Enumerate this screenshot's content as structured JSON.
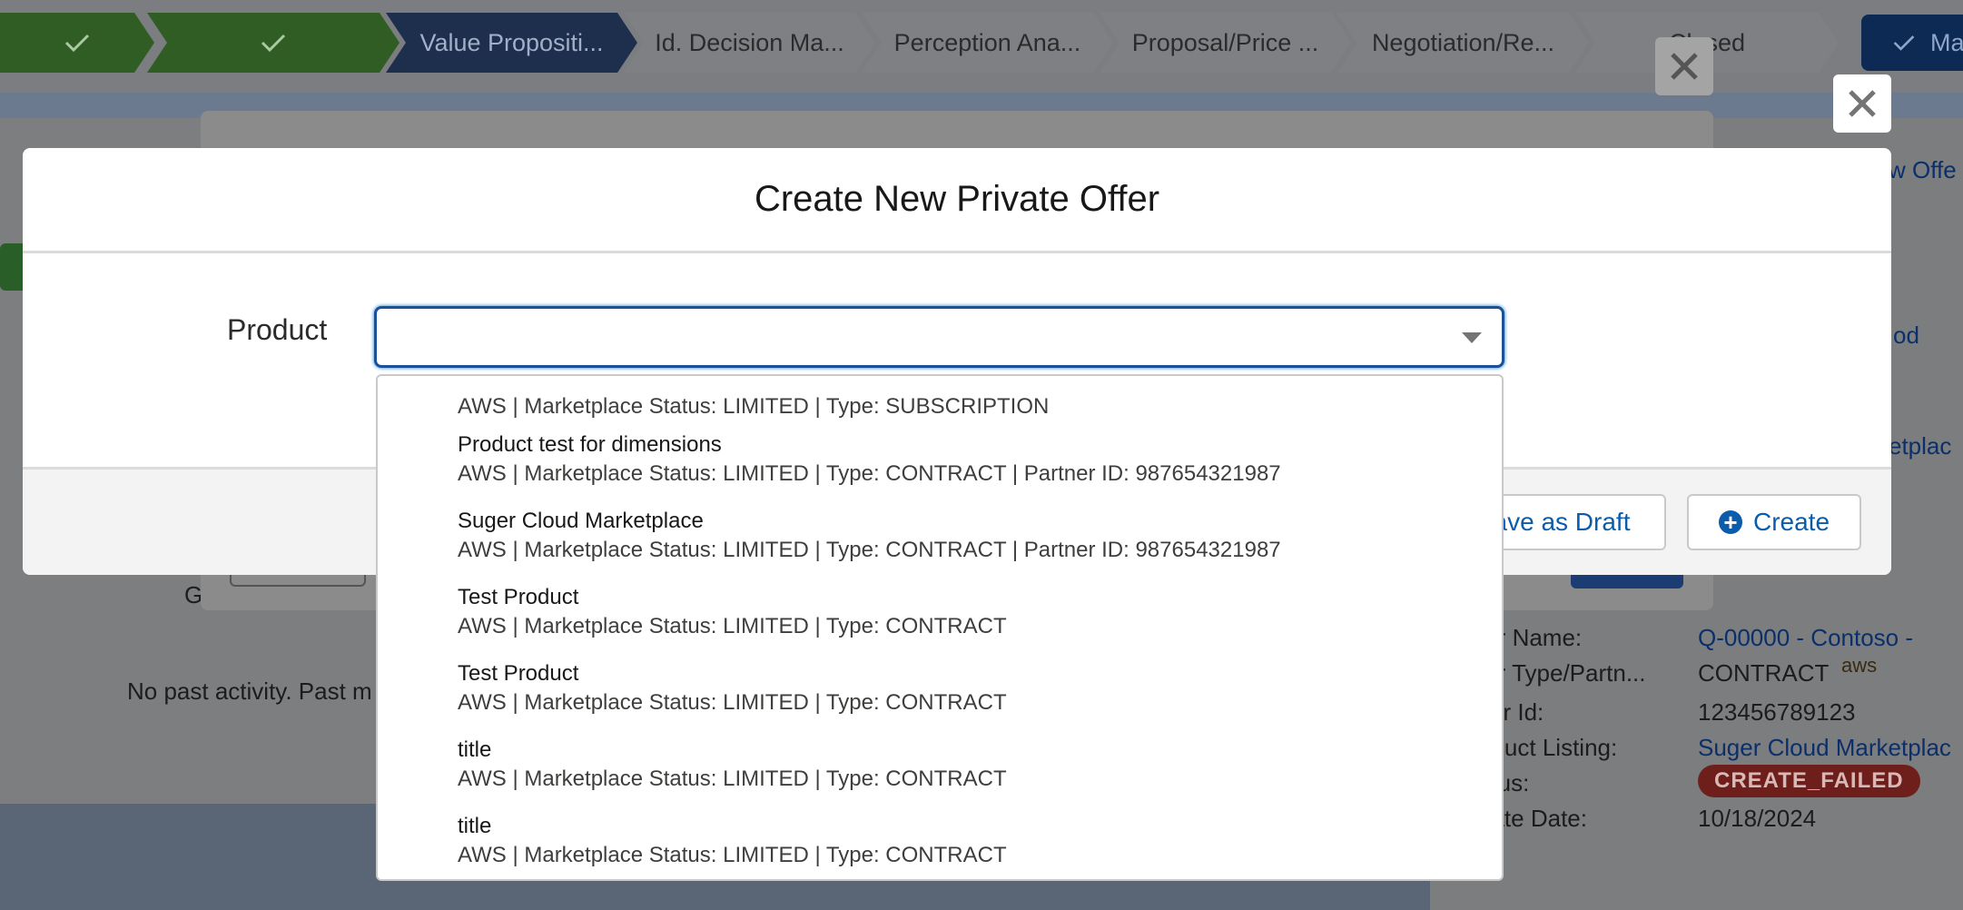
{
  "path": {
    "stages": [
      {
        "label": "",
        "state": "done"
      },
      {
        "label": "",
        "state": "done"
      },
      {
        "label": "Value Propositi...",
        "state": "current"
      },
      {
        "label": "Id. Decision Ma...",
        "state": "todo"
      },
      {
        "label": "Perception Ana...",
        "state": "todo"
      },
      {
        "label": "Proposal/Price ...",
        "state": "todo"
      },
      {
        "label": "Negotiation/Re...",
        "state": "todo"
      },
      {
        "label": "Closed",
        "state": "todo"
      }
    ],
    "mark_button_label": "Ma"
  },
  "background": {
    "activity_empty_text": "No past activity. Past m",
    "left_g_text": "G",
    "new_offer_link": "w Offe",
    "right_link_1": "od",
    "right_link_2": "etplac",
    "details": {
      "offer_name_label": "fer Name:",
      "offer_name_value": "Q-00000 - Contoso -",
      "offer_type_label": "fer Type/Partn...",
      "offer_type_value": "CONTRACT",
      "offer_type_logo": "aws",
      "buyer_id_label": "yer Id:",
      "buyer_id_value": "123456789123",
      "product_listing_label": "oduct Listing:",
      "product_listing_value": "Suger Cloud Marketplac",
      "status_label": "atus:",
      "status_value": "CREATE_FAILED",
      "create_date_label": "eate Date:",
      "create_date_value": "10/18/2024"
    }
  },
  "modal": {
    "title": "Create New Private Offer",
    "product_label": "Product",
    "product_value": "",
    "save_draft_label": "ave as Draft",
    "create_label": "Create"
  },
  "dropdown": {
    "partial_top_meta": "AWS | Marketplace Status: LIMITED | Type: SUBSCRIPTION",
    "items": [
      {
        "title": "Product test for dimensions",
        "meta": "AWS | Marketplace Status: LIMITED | Type: CONTRACT | Partner ID: 987654321987"
      },
      {
        "title": "Suger Cloud Marketplace",
        "meta": "AWS | Marketplace Status: LIMITED | Type: CONTRACT | Partner ID: 987654321987"
      },
      {
        "title": "Test Product",
        "meta": "AWS | Marketplace Status: LIMITED | Type: CONTRACT"
      },
      {
        "title": "Test Product",
        "meta": "AWS | Marketplace Status: LIMITED | Type: CONTRACT"
      },
      {
        "title": "title",
        "meta": "AWS | Marketplace Status: LIMITED | Type: CONTRACT"
      },
      {
        "title": "title",
        "meta": "AWS | Marketplace Status: LIMITED | Type: CONTRACT"
      }
    ]
  },
  "colors": {
    "brand_blue": "#0b5cab",
    "focus_border": "#1b5297",
    "failed_badge": "#ba0517"
  }
}
